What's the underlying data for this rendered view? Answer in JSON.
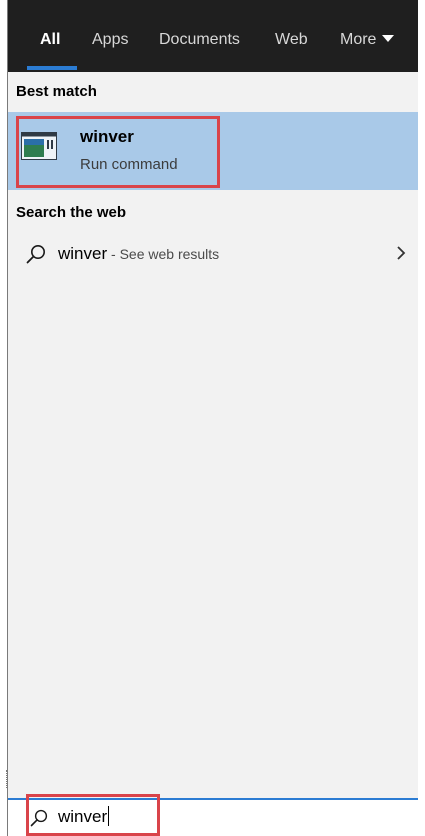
{
  "tabs": [
    {
      "label": "All",
      "active": true
    },
    {
      "label": "Apps",
      "active": false
    },
    {
      "label": "Documents",
      "active": false
    },
    {
      "label": "Web",
      "active": false
    },
    {
      "label": "More",
      "active": false
    }
  ],
  "best_match": {
    "header": "Best match",
    "title": "winver",
    "subtitle": "Run command",
    "icon": "run-command-icon"
  },
  "search_web": {
    "header": "Search the web",
    "query": "winver",
    "separator": " - ",
    "hint": "See web results",
    "icon": "search-icon",
    "arrow_icon": "chevron-right-icon"
  },
  "search_box": {
    "value": "winver",
    "icon": "search-icon"
  },
  "colors": {
    "tabbar_bg": "#1f1f1f",
    "accent": "#2b7cd3",
    "selected_row": "#a9c9e8",
    "panel_bg": "#f2f2f2",
    "highlight_box": "#d9444a"
  }
}
